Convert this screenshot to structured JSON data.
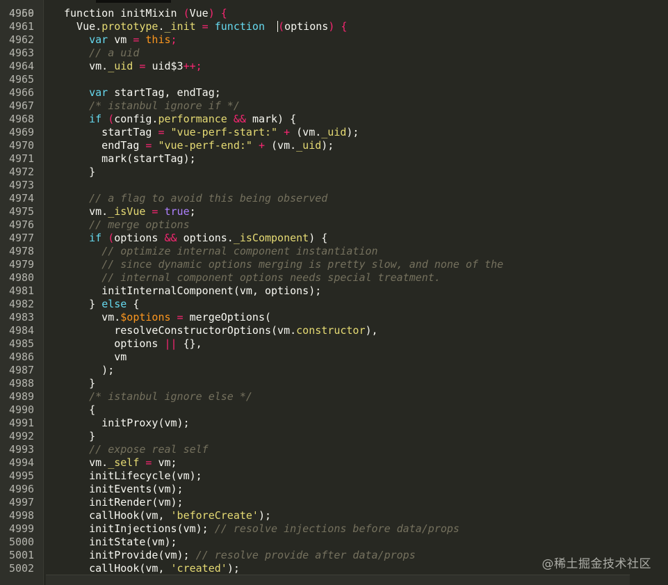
{
  "editor": {
    "first_partial_line": "4959",
    "last_partial_line": "5003",
    "lines": [
      {
        "n": "4960",
        "t": [
          [
            "fn",
            "function "
          ],
          [
            "ident",
            "initMixin "
          ],
          [
            "op",
            "("
          ],
          [
            "ident",
            "Vue"
          ],
          [
            "op",
            ") {"
          ]
        ]
      },
      {
        "n": "4961",
        "t": [
          [
            "ident",
            "  Vue."
          ],
          [
            "prop",
            "prototype"
          ],
          [
            "ident",
            "."
          ],
          [
            "prop",
            "_init"
          ],
          [
            "op",
            " = "
          ],
          [
            "kw",
            "function "
          ],
          [
            "ident",
            " "
          ],
          [
            "caret",
            ""
          ],
          [
            "op",
            "("
          ],
          [
            "ident",
            "options"
          ],
          [
            "op",
            ") {"
          ]
        ]
      },
      {
        "n": "4962",
        "t": [
          [
            "ident",
            "    "
          ],
          [
            "kw",
            "var "
          ],
          [
            "ident",
            "vm "
          ],
          [
            "op",
            "= "
          ],
          [
            "this",
            "this"
          ],
          [
            "op",
            ";"
          ]
        ]
      },
      {
        "n": "4963",
        "t": [
          [
            "ident",
            "    "
          ],
          [
            "cm",
            "// a uid"
          ]
        ]
      },
      {
        "n": "4964",
        "t": [
          [
            "ident",
            "    vm."
          ],
          [
            "prop",
            "_uid"
          ],
          [
            "op",
            " = "
          ],
          [
            "ident",
            "uid$3"
          ],
          [
            "op",
            "++;"
          ]
        ]
      },
      {
        "n": "4965",
        "t": []
      },
      {
        "n": "4966",
        "t": [
          [
            "ident",
            "    "
          ],
          [
            "kw",
            "var "
          ],
          [
            "ident",
            "startTag, endTag;"
          ]
        ]
      },
      {
        "n": "4967",
        "t": [
          [
            "ident",
            "    "
          ],
          [
            "cm",
            "/* istanbul ignore if */"
          ]
        ]
      },
      {
        "n": "4968",
        "t": [
          [
            "ident",
            "    "
          ],
          [
            "kw",
            "if "
          ],
          [
            "op",
            "("
          ],
          [
            "ident",
            "config."
          ],
          [
            "prop",
            "performance"
          ],
          [
            "op",
            " && "
          ],
          [
            "ident",
            "mark) {"
          ]
        ]
      },
      {
        "n": "4969",
        "t": [
          [
            "ident",
            "      startTag "
          ],
          [
            "op",
            "= "
          ],
          [
            "str",
            "\"vue-perf-start:\""
          ],
          [
            "op",
            " + "
          ],
          [
            "ident",
            "(vm."
          ],
          [
            "prop",
            "_uid"
          ],
          [
            "ident",
            ");"
          ]
        ]
      },
      {
        "n": "4970",
        "t": [
          [
            "ident",
            "      endTag "
          ],
          [
            "op",
            "= "
          ],
          [
            "str",
            "\"vue-perf-end:\""
          ],
          [
            "op",
            " + "
          ],
          [
            "ident",
            "(vm."
          ],
          [
            "prop",
            "_uid"
          ],
          [
            "ident",
            ");"
          ]
        ]
      },
      {
        "n": "4971",
        "t": [
          [
            "ident",
            "      mark(startTag);"
          ]
        ]
      },
      {
        "n": "4972",
        "t": [
          [
            "ident",
            "    }"
          ]
        ]
      },
      {
        "n": "4973",
        "t": []
      },
      {
        "n": "4974",
        "t": [
          [
            "ident",
            "    "
          ],
          [
            "cm",
            "// a flag to avoid this being observed"
          ]
        ]
      },
      {
        "n": "4975",
        "t": [
          [
            "ident",
            "    vm."
          ],
          [
            "prop",
            "_isVue"
          ],
          [
            "op",
            " = "
          ],
          [
            "true",
            "true"
          ],
          [
            "ident",
            ";"
          ]
        ]
      },
      {
        "n": "4976",
        "t": [
          [
            "ident",
            "    "
          ],
          [
            "cm",
            "// merge options"
          ]
        ]
      },
      {
        "n": "4977",
        "t": [
          [
            "ident",
            "    "
          ],
          [
            "kw",
            "if "
          ],
          [
            "op",
            "("
          ],
          [
            "ident",
            "options "
          ],
          [
            "op",
            "&& "
          ],
          [
            "ident",
            "options."
          ],
          [
            "prop",
            "_isComponent"
          ],
          [
            "ident",
            ") {"
          ]
        ]
      },
      {
        "n": "4978",
        "t": [
          [
            "ident",
            "      "
          ],
          [
            "cm",
            "// optimize internal component instantiation"
          ]
        ]
      },
      {
        "n": "4979",
        "t": [
          [
            "ident",
            "      "
          ],
          [
            "cm",
            "// since dynamic options merging is pretty slow, and none of the"
          ]
        ]
      },
      {
        "n": "4980",
        "t": [
          [
            "ident",
            "      "
          ],
          [
            "cm",
            "// internal component options needs special treatment."
          ]
        ]
      },
      {
        "n": "4981",
        "t": [
          [
            "ident",
            "      initInternalComponent(vm, options);"
          ]
        ]
      },
      {
        "n": "4982",
        "t": [
          [
            "ident",
            "    } "
          ],
          [
            "kw",
            "else "
          ],
          [
            "ident",
            "{"
          ]
        ]
      },
      {
        "n": "4983",
        "t": [
          [
            "ident",
            "      vm."
          ],
          [
            "this",
            "$options"
          ],
          [
            "op",
            " = "
          ],
          [
            "ident",
            "mergeOptions("
          ]
        ]
      },
      {
        "n": "4984",
        "t": [
          [
            "ident",
            "        resolveConstructorOptions(vm."
          ],
          [
            "prop",
            "constructor"
          ],
          [
            "ident",
            "),"
          ]
        ]
      },
      {
        "n": "4985",
        "t": [
          [
            "ident",
            "        options "
          ],
          [
            "op",
            "|| "
          ],
          [
            "ident",
            "{},"
          ]
        ]
      },
      {
        "n": "4986",
        "t": [
          [
            "ident",
            "        vm"
          ]
        ]
      },
      {
        "n": "4987",
        "t": [
          [
            "ident",
            "      );"
          ]
        ]
      },
      {
        "n": "4988",
        "t": [
          [
            "ident",
            "    }"
          ]
        ]
      },
      {
        "n": "4989",
        "t": [
          [
            "ident",
            "    "
          ],
          [
            "cm",
            "/* istanbul ignore else */"
          ]
        ]
      },
      {
        "n": "4990",
        "t": [
          [
            "ident",
            "    {"
          ]
        ]
      },
      {
        "n": "4991",
        "t": [
          [
            "ident",
            "      initProxy(vm);"
          ]
        ]
      },
      {
        "n": "4992",
        "t": [
          [
            "ident",
            "    }"
          ]
        ]
      },
      {
        "n": "4993",
        "t": [
          [
            "ident",
            "    "
          ],
          [
            "cm",
            "// expose real self"
          ]
        ]
      },
      {
        "n": "4994",
        "t": [
          [
            "ident",
            "    vm."
          ],
          [
            "prop",
            "_self"
          ],
          [
            "op",
            " = "
          ],
          [
            "ident",
            "vm;"
          ]
        ]
      },
      {
        "n": "4995",
        "t": [
          [
            "ident",
            "    initLifecycle(vm);"
          ]
        ]
      },
      {
        "n": "4996",
        "t": [
          [
            "ident",
            "    initEvents(vm);"
          ]
        ]
      },
      {
        "n": "4997",
        "t": [
          [
            "ident",
            "    initRender(vm);"
          ]
        ]
      },
      {
        "n": "4998",
        "t": [
          [
            "ident",
            "    callHook(vm, "
          ],
          [
            "str",
            "'beforeCreate'"
          ],
          [
            "ident",
            ");"
          ]
        ]
      },
      {
        "n": "4999",
        "t": [
          [
            "ident",
            "    initInjections(vm); "
          ],
          [
            "cm",
            "// resolve injections before data/props"
          ]
        ]
      },
      {
        "n": "5000",
        "t": [
          [
            "ident",
            "    initState(vm);"
          ]
        ]
      },
      {
        "n": "5001",
        "t": [
          [
            "ident",
            "    initProvide(vm); "
          ],
          [
            "cm",
            "// resolve provide after data/props"
          ]
        ]
      },
      {
        "n": "5002",
        "t": [
          [
            "ident",
            "    callHook(vm, "
          ],
          [
            "str",
            "'created'"
          ],
          [
            "ident",
            ");"
          ]
        ]
      }
    ]
  },
  "watermark": "@稀土掘金技术社区",
  "colors": {
    "background": "#272822",
    "gutter": "#2f302a",
    "keyword": "#66d9ef",
    "operator": "#f92672",
    "string": "#e6db74",
    "comment": "#75715e",
    "constant": "#ae81ff",
    "variable": "#fd971f",
    "text": "#f8f8f2"
  }
}
